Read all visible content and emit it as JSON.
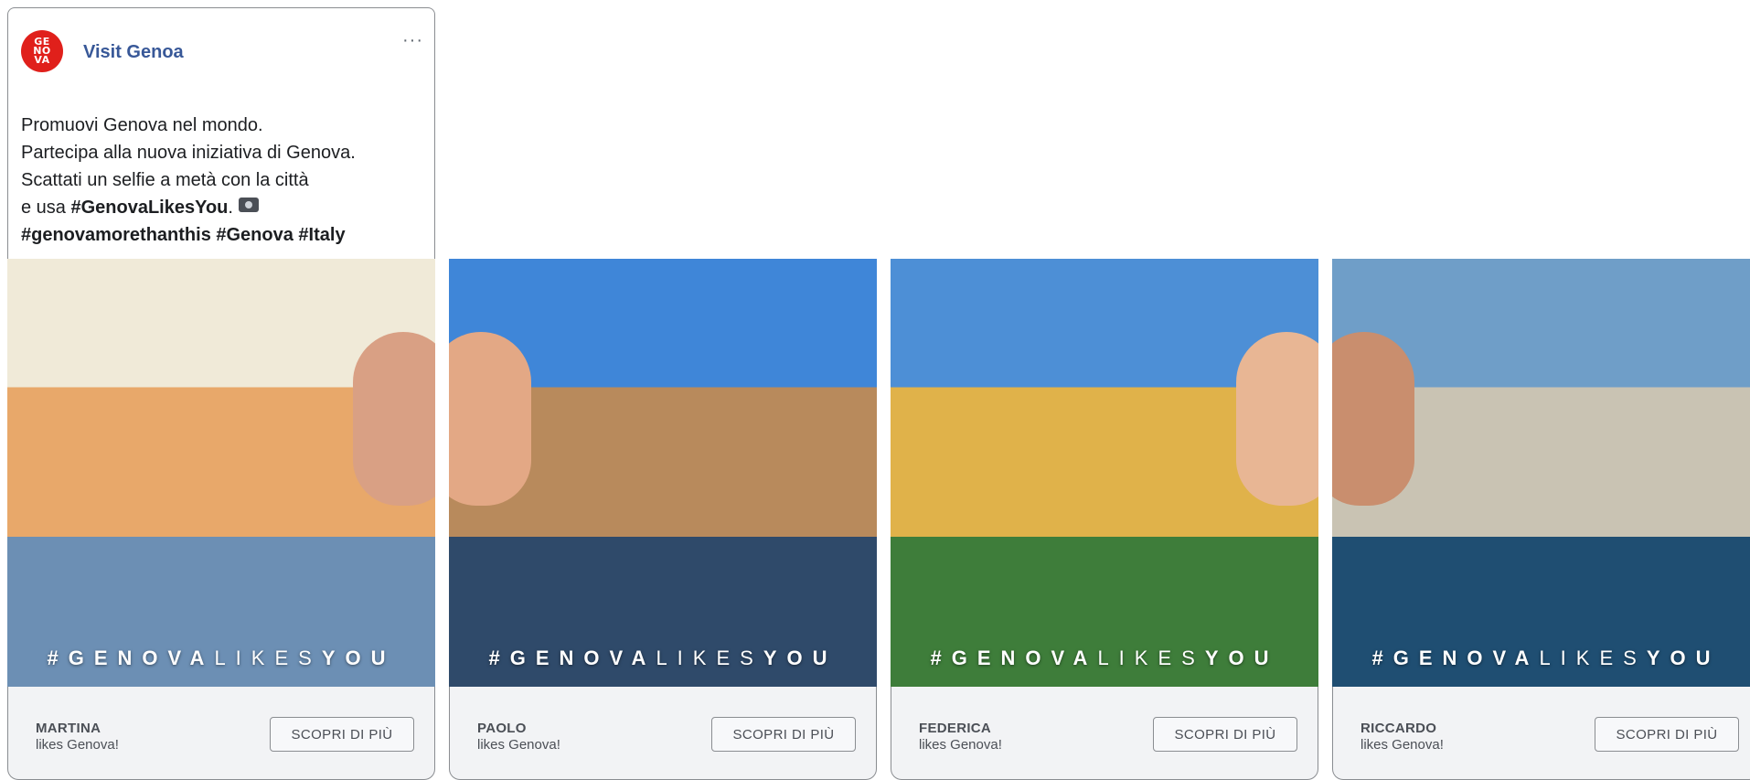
{
  "post": {
    "page_name": "Visit Genoa",
    "avatar_logo": "GE\nNO\nVA",
    "text_lines": [
      "Promuovi Genova nel mondo.",
      "Partecipa alla nuova iniziativa di Genova.",
      "Scattati un selfie a metà con la città"
    ],
    "line4_prefix": "e usa ",
    "line4_tag": "#GenovaLikesYou",
    "line4_suffix": ".",
    "line5_tags": "#genovamorethanthis #Genova #Italy",
    "emoji_icon": "camera-icon",
    "menu_icon": "more-horizontal-icon"
  },
  "overlay": {
    "bold_a": "#GENOVA",
    "thin": "LIKES",
    "bold_b": "YOU"
  },
  "cards": [
    {
      "name": "MARTINA",
      "subtitle": "likes Genova!",
      "cta": "SCOPRI DI PIÙ",
      "scene": "colorful-harbor-houses",
      "sky": "#f0ead8",
      "main": "#e8a86a",
      "water": "#6c8fb4",
      "face": "#d9a084"
    },
    {
      "name": "PAOLO",
      "subtitle": "likes Genova!",
      "cta": "SCOPRI DI PIÙ",
      "scene": "piazza-fountain-palace",
      "sky": "#3f86d8",
      "main": "#b88a5c",
      "water": "#2f4a6a",
      "face": "#e3a885"
    },
    {
      "name": "FEDERICA",
      "subtitle": "likes Genova!",
      "cta": "SCOPRI DI PIÙ",
      "scene": "palazzo-archway-garden",
      "sky": "#4d8fd6",
      "main": "#e0b24a",
      "water": "#3e7d3a",
      "face": "#e8b694"
    },
    {
      "name": "RICCARDO",
      "subtitle": "likes Genova!",
      "cta": "SCOPRI DI PIÙ",
      "scene": "seaside-coastline",
      "sky": "#6f9ec8",
      "main": "#c9c3b3",
      "water": "#1f4e72",
      "face": "#c98e6e"
    }
  ]
}
